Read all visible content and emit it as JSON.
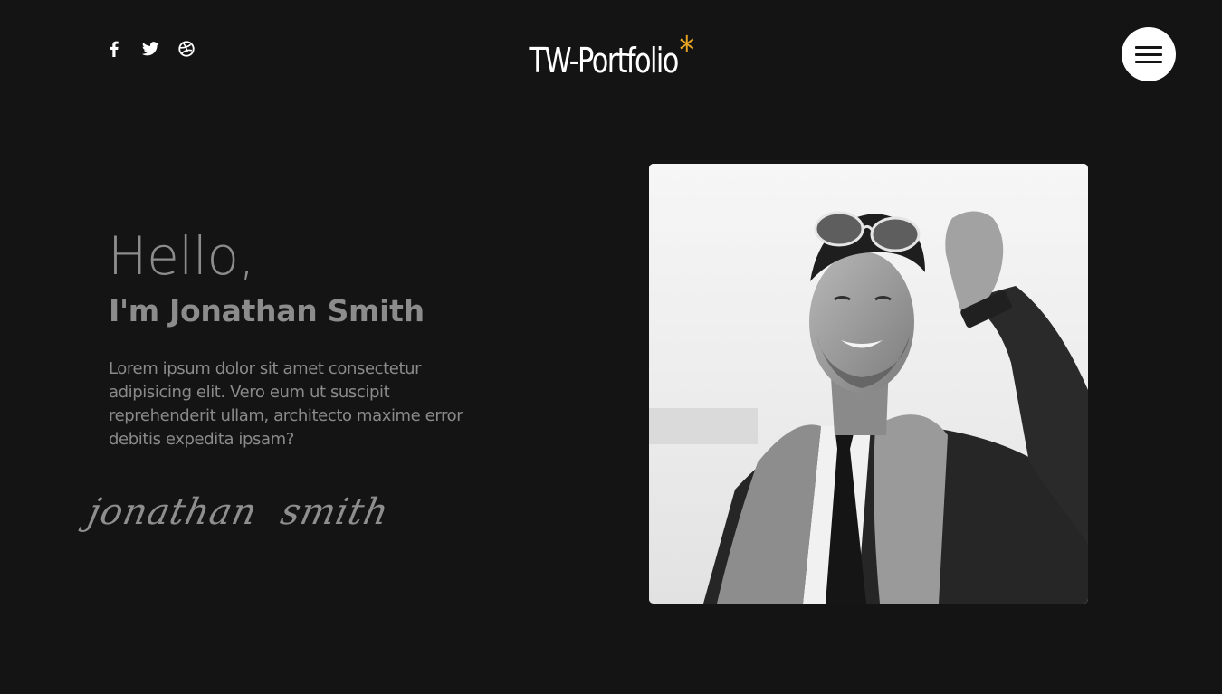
{
  "header": {
    "brand_name": "TW-Portfolio",
    "brand_mark": "*",
    "social": [
      {
        "icon": "facebook-icon"
      },
      {
        "icon": "twitter-icon"
      },
      {
        "icon": "dribbble-icon"
      }
    ],
    "menu_icon": "hamburger-icon"
  },
  "hero": {
    "greeting": "Hello,",
    "intro_name": "I'm Jonathan Smith",
    "description": "Lorem ipsum dolor sit amet consectetur adipisicing elit. Vero eum ut suscipit reprehenderit ullam, architecto maxime error debitis expedita ipsam?",
    "signature": "jonathan  smith"
  },
  "colors": {
    "background": "#141414",
    "accent": "#e7a321",
    "text_muted": "#8c8c8c",
    "brand_text": "#ffffff",
    "menu_button": "#ffffff"
  }
}
